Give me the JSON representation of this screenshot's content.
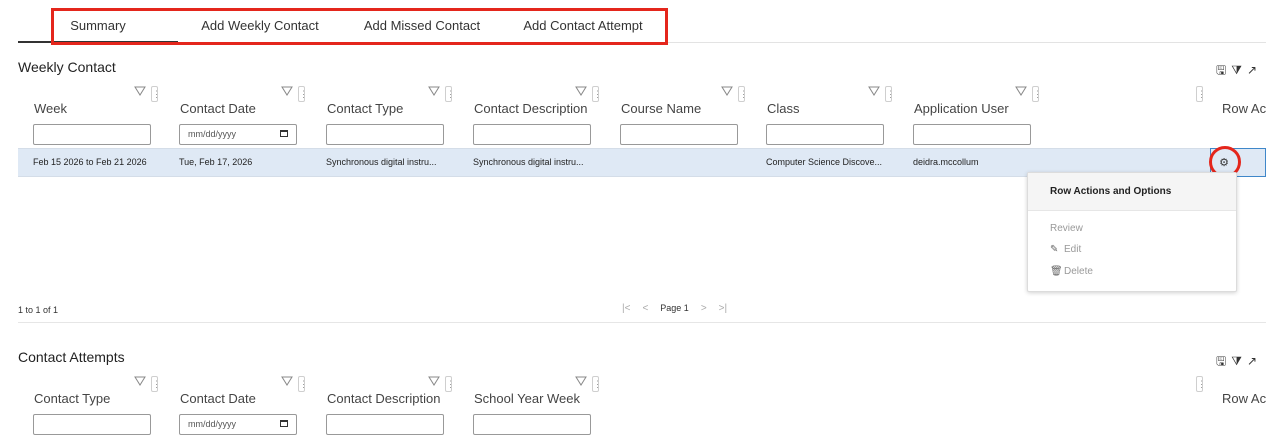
{
  "tabs": [
    {
      "label": "Summary",
      "active": true
    },
    {
      "label": "Add Weekly Contact",
      "active": false
    },
    {
      "label": "Add Missed Contact",
      "active": false
    },
    {
      "label": "Add Contact Attempt",
      "active": false
    }
  ],
  "highlight_color": "#e4261c",
  "weekly": {
    "title": "Weekly Contact",
    "icons": [
      "save-icon",
      "filter-list-icon",
      "link-icon"
    ],
    "columns": [
      "Week",
      "Contact Date",
      "Contact Type",
      "Contact Description",
      "Course Name",
      "Class",
      "Application User",
      "Row Ac"
    ],
    "date_placeholder": "mm/dd/yyyy",
    "row": {
      "week": "Feb 15 2026 to Feb 21 2026",
      "contact_date": "Tue, Feb 17, 2026",
      "contact_type": "Synchronous digital instru...",
      "contact_description": "Synchronous digital instru...",
      "course_name": "",
      "class": "Computer Science Discove...",
      "application_user": "deidra.mccollum"
    },
    "pager": {
      "info": "1 to 1 of 1",
      "page_label": "Page 1"
    }
  },
  "row_actions": {
    "title": "Row Actions and Options",
    "items": [
      "Review",
      "Edit",
      "Delete"
    ]
  },
  "attempts": {
    "title": "Contact Attempts",
    "columns": [
      "Contact Type",
      "Contact Date",
      "Contact Description",
      "School Year Week",
      "Row Ac"
    ],
    "date_placeholder": "mm/dd/yyyy"
  }
}
